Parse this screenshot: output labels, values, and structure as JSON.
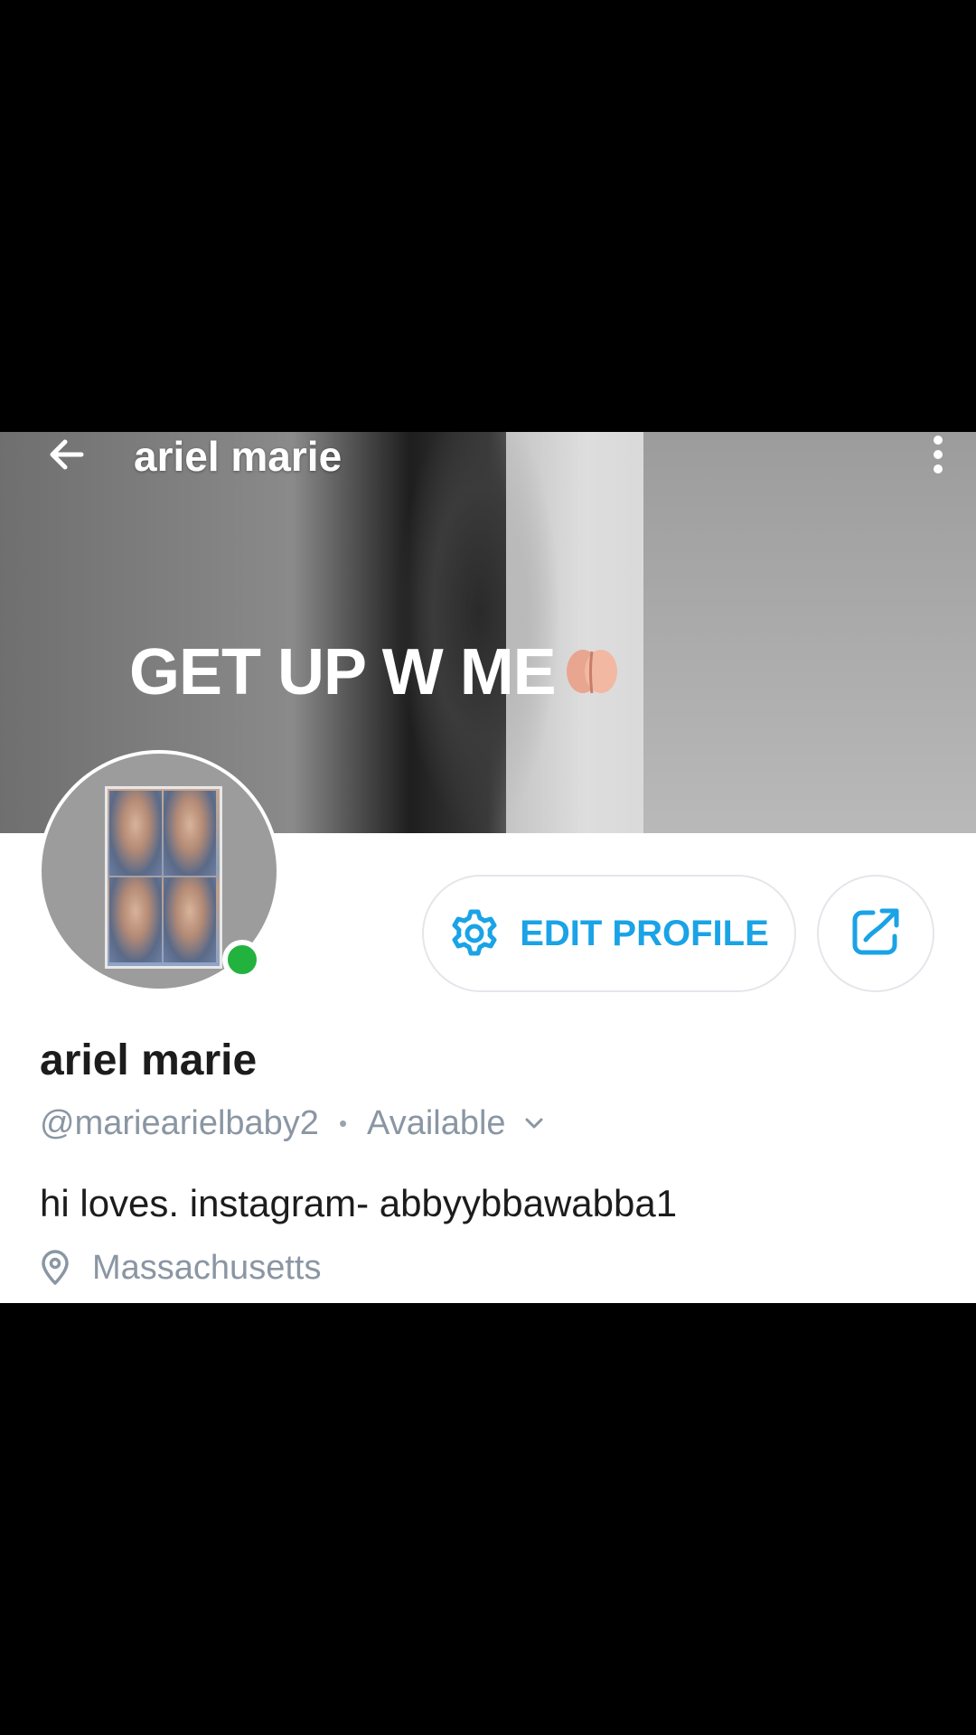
{
  "header": {
    "title": "ariel marie",
    "back_icon": "arrow-left-icon",
    "more_icon": "kebab-menu-icon"
  },
  "cover": {
    "caption": "GET UP W ME",
    "caption_emoji": "peach-emoji-icon"
  },
  "profile": {
    "display_name": "ariel marie",
    "handle": "@mariearielbaby2",
    "status": "Available",
    "online": true,
    "bio": "hi loves. instagram- abbyybbawabba1",
    "location": "Massachusetts"
  },
  "actions": {
    "edit_profile_label": "EDIT PROFILE",
    "edit_icon": "gear-icon",
    "share_icon": "share-icon"
  },
  "colors": {
    "accent": "#1aa3e6",
    "online": "#22b33e",
    "muted_text": "#8a96a3",
    "background": "#ffffff",
    "letterbox": "#000000"
  }
}
